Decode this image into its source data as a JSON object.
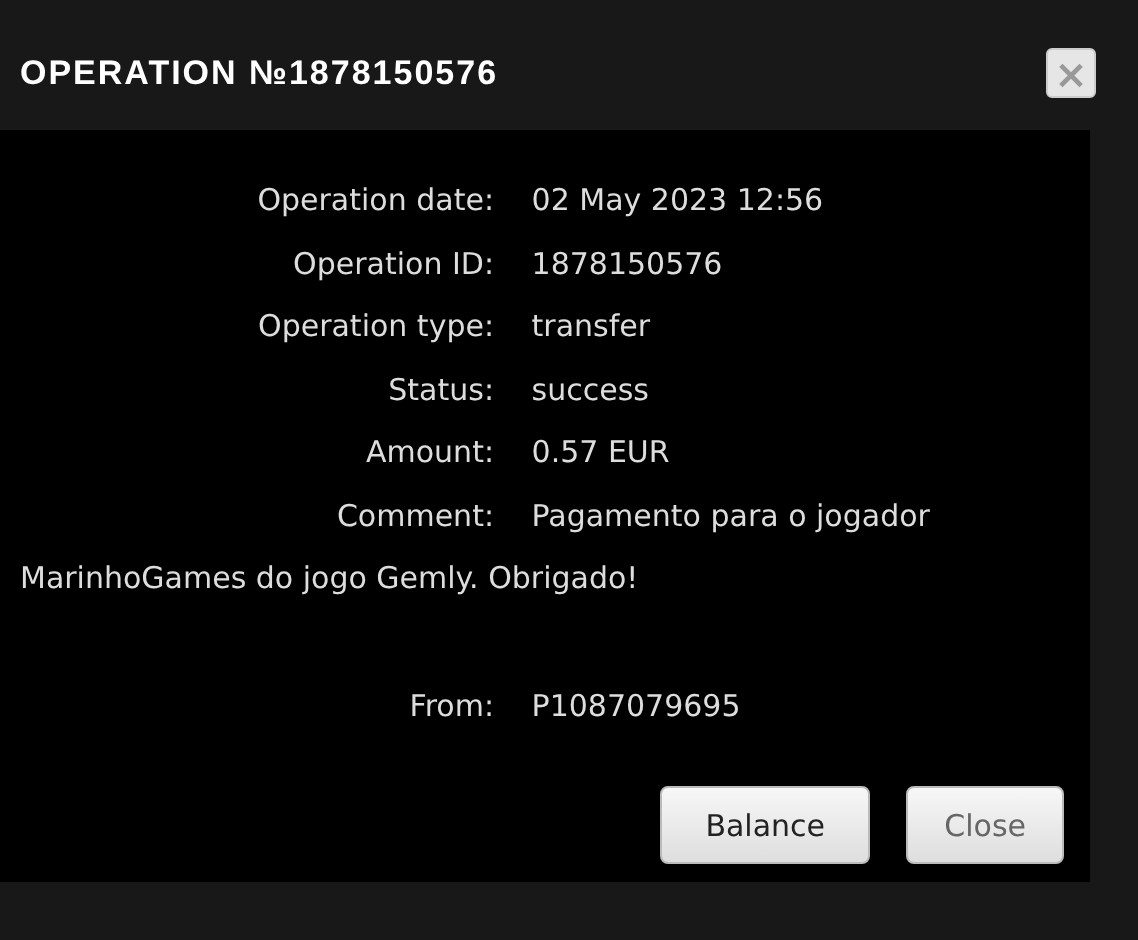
{
  "window": {
    "title": "OPERATION №1878150576",
    "close_icon": "×"
  },
  "fields": [
    {
      "label": "Operation date:",
      "value": "02 May 2023 12:56"
    },
    {
      "label": "Operation ID:",
      "value": "1878150576"
    },
    {
      "label": "Operation type:",
      "value": "transfer"
    },
    {
      "label": "Status:",
      "value": "success"
    },
    {
      "label": "Amount:",
      "value": "0.57 EUR"
    },
    {
      "label": "Comment:",
      "value": "Pagamento para o jogador MarinhoGames do jogo Gemly. Obrigado!",
      "kind": "paragraph"
    },
    {
      "label": "From:",
      "value": "P1087079695"
    }
  ],
  "buttons": [
    {
      "label": "Balance",
      "primary": true
    },
    {
      "label": "Close",
      "primary": false
    }
  ]
}
